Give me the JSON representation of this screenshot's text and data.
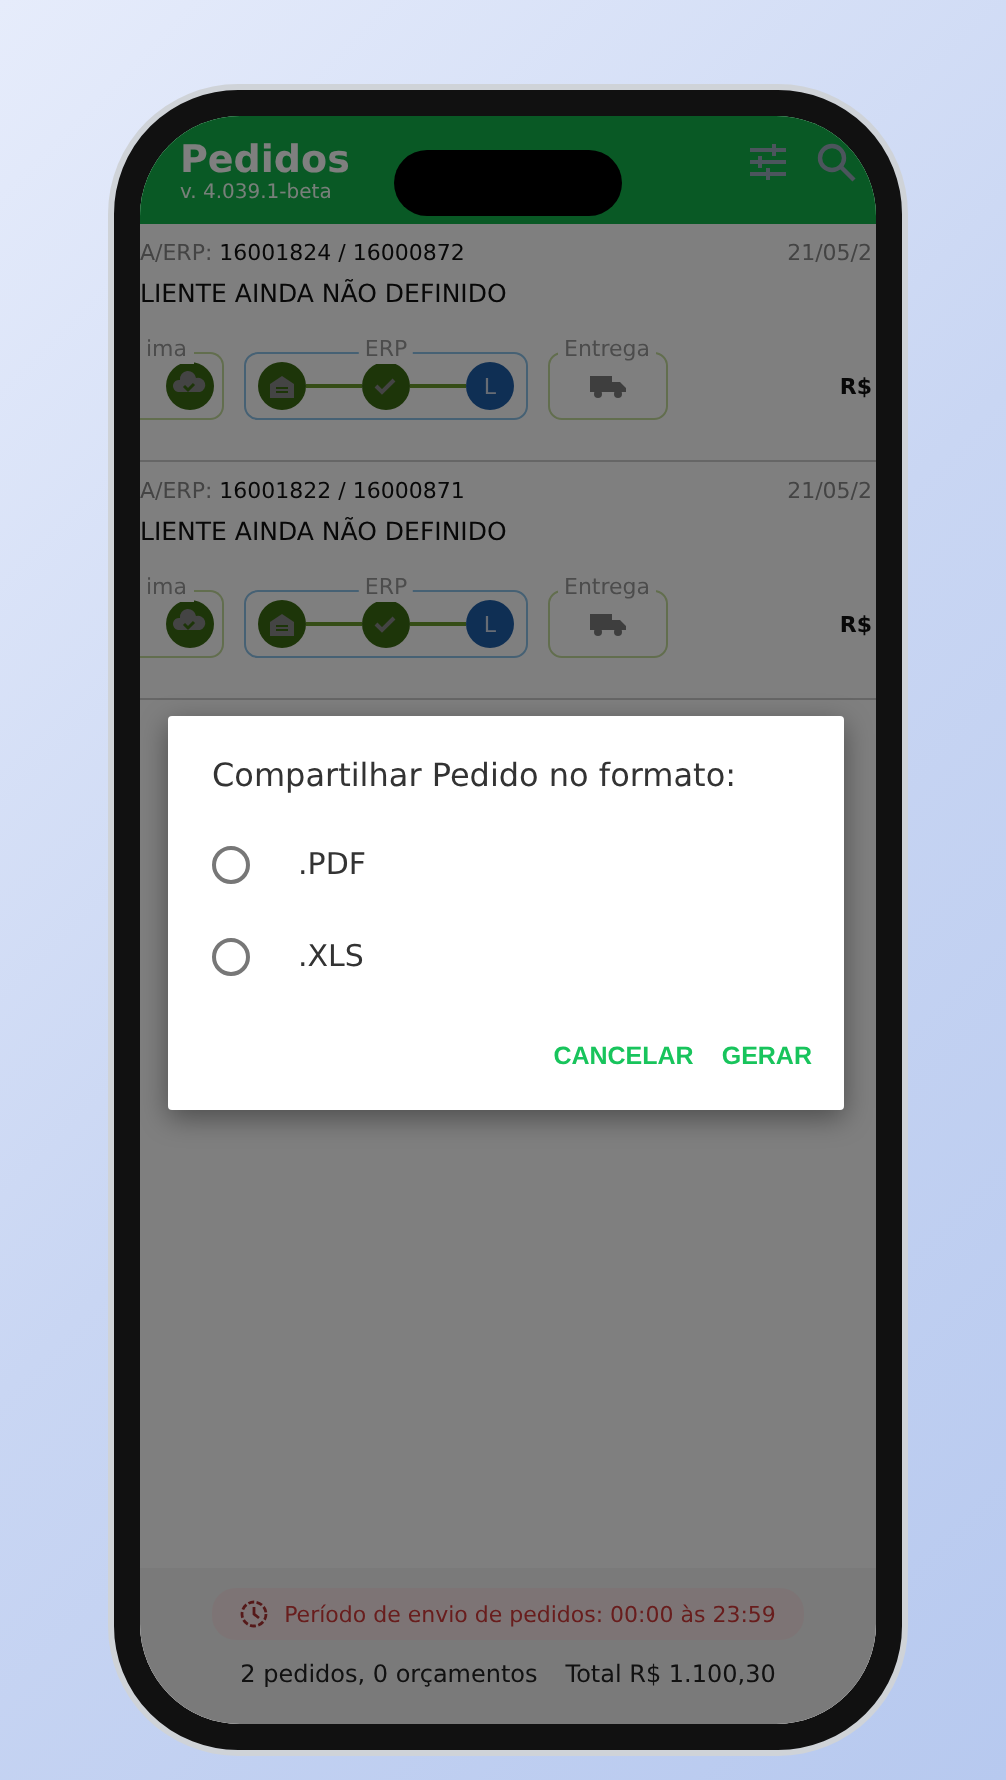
{
  "header": {
    "title": "Pedidos",
    "version": "v. 4.039.1-beta"
  },
  "orders": [
    {
      "label": "A/ERP:",
      "numbers": "16001824 / 16000872",
      "date": "21/05/2",
      "client": "LIENTE AINDA NÃO DEFINIDO",
      "amount": "R$",
      "stages": [
        {
          "kind": "cloud",
          "label": "ima",
          "done": true
        },
        {
          "kind": "erp",
          "label": "ERP",
          "done": true,
          "letter": "L"
        },
        {
          "kind": "delivery",
          "label": "Entrega",
          "done": false
        }
      ]
    },
    {
      "label": "A/ERP:",
      "numbers": "16001822 / 16000871",
      "date": "21/05/2",
      "client": "LIENTE AINDA NÃO DEFINIDO",
      "amount": "R$",
      "stages": [
        {
          "kind": "cloud",
          "label": "ima",
          "done": true
        },
        {
          "kind": "erp",
          "label": "ERP",
          "done": true,
          "letter": "L"
        },
        {
          "kind": "delivery",
          "label": "Entrega",
          "done": false
        }
      ]
    }
  ],
  "dialog": {
    "title": "Compartilhar Pedido no formato:",
    "options": [
      {
        "label": ".PDF",
        "selected": false
      },
      {
        "label": ".XLS",
        "selected": false
      }
    ],
    "buttons": [
      "CANCELAR",
      "GERAR"
    ]
  },
  "footer": {
    "notice": "Período de envio de pedidos: 00:00 às 23:59",
    "summary": "2 pedidos, 0 orçamentos",
    "total": "Total R$ 1.100,30"
  }
}
